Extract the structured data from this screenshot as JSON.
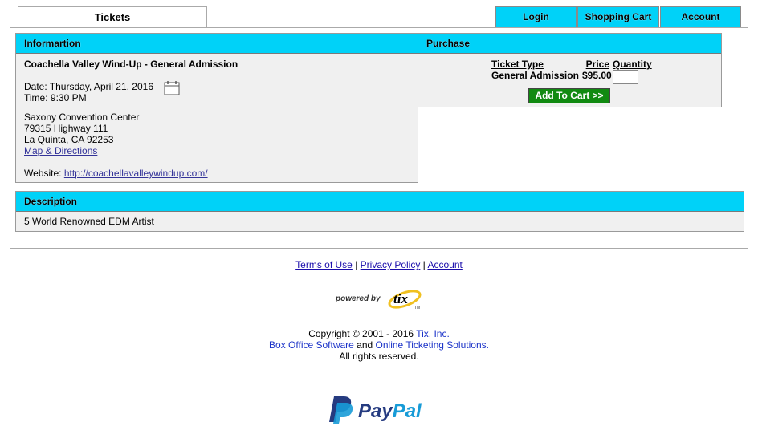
{
  "tabs": {
    "tickets": "Tickets"
  },
  "nav": {
    "login": "Login",
    "cart": "Shopping Cart",
    "account": "Account"
  },
  "info": {
    "header": "Informartion",
    "title": "Coachella Valley Wind-Up - General Admission",
    "date": "Date: Thursday, April 21, 2016",
    "time": "Time: 9:30 PM",
    "venue": "Saxony Convention Center",
    "address1": "79315 Highway 111",
    "address2": "La Quinta, CA 92253",
    "map_link": "Map & Directions",
    "website_label": "Website: ",
    "website_url": "http://coachellavalleywindup.com/"
  },
  "purchase": {
    "header": "Purchase",
    "col_type": "Ticket Type",
    "col_price": "Price",
    "col_qty": "Quantity",
    "ticket_type": "General Admission",
    "price": "$95.00",
    "qty_value": "",
    "add_button": "Add To Cart >>"
  },
  "description": {
    "header": "Description",
    "text": "5 World Renowned EDM Artist"
  },
  "footer": {
    "terms": "Terms of Use",
    "privacy": "Privacy Policy",
    "account": "Account",
    "sep": " | ",
    "powered_by": "powered by",
    "tix_logo": "tix",
    "tm": "TM",
    "copyright": "Copyright © 2001 - 2016 ",
    "tix_inc": "Tix, Inc.",
    "box_office": "Box Office Software",
    "and": " and ",
    "online": "Online Ticketing Solutions.",
    "rights": "All rights reserved.",
    "paypal_text": "PayPal",
    "paypal_pay": "Pay",
    "paypal_pal": "Pal"
  },
  "colors": {
    "header_bg": "#00d2f8",
    "button_green": "#118a11",
    "paypal_dark": "#253b80",
    "paypal_light": "#179bd7"
  },
  "icons": {
    "calendar": "calendar-icon"
  }
}
